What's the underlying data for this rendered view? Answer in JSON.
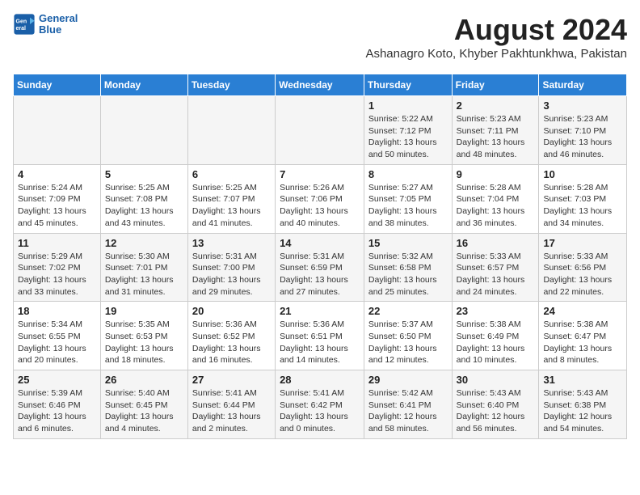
{
  "header": {
    "logo_line1": "General",
    "logo_line2": "Blue",
    "month_title": "August 2024",
    "subtitle": "Ashanagro Koto, Khyber Pakhtunkhwa, Pakistan"
  },
  "weekdays": [
    "Sunday",
    "Monday",
    "Tuesday",
    "Wednesday",
    "Thursday",
    "Friday",
    "Saturday"
  ],
  "weeks": [
    [
      {
        "day": "",
        "info": ""
      },
      {
        "day": "",
        "info": ""
      },
      {
        "day": "",
        "info": ""
      },
      {
        "day": "",
        "info": ""
      },
      {
        "day": "1",
        "info": "Sunrise: 5:22 AM\nSunset: 7:12 PM\nDaylight: 13 hours\nand 50 minutes."
      },
      {
        "day": "2",
        "info": "Sunrise: 5:23 AM\nSunset: 7:11 PM\nDaylight: 13 hours\nand 48 minutes."
      },
      {
        "day": "3",
        "info": "Sunrise: 5:23 AM\nSunset: 7:10 PM\nDaylight: 13 hours\nand 46 minutes."
      }
    ],
    [
      {
        "day": "4",
        "info": "Sunrise: 5:24 AM\nSunset: 7:09 PM\nDaylight: 13 hours\nand 45 minutes."
      },
      {
        "day": "5",
        "info": "Sunrise: 5:25 AM\nSunset: 7:08 PM\nDaylight: 13 hours\nand 43 minutes."
      },
      {
        "day": "6",
        "info": "Sunrise: 5:25 AM\nSunset: 7:07 PM\nDaylight: 13 hours\nand 41 minutes."
      },
      {
        "day": "7",
        "info": "Sunrise: 5:26 AM\nSunset: 7:06 PM\nDaylight: 13 hours\nand 40 minutes."
      },
      {
        "day": "8",
        "info": "Sunrise: 5:27 AM\nSunset: 7:05 PM\nDaylight: 13 hours\nand 38 minutes."
      },
      {
        "day": "9",
        "info": "Sunrise: 5:28 AM\nSunset: 7:04 PM\nDaylight: 13 hours\nand 36 minutes."
      },
      {
        "day": "10",
        "info": "Sunrise: 5:28 AM\nSunset: 7:03 PM\nDaylight: 13 hours\nand 34 minutes."
      }
    ],
    [
      {
        "day": "11",
        "info": "Sunrise: 5:29 AM\nSunset: 7:02 PM\nDaylight: 13 hours\nand 33 minutes."
      },
      {
        "day": "12",
        "info": "Sunrise: 5:30 AM\nSunset: 7:01 PM\nDaylight: 13 hours\nand 31 minutes."
      },
      {
        "day": "13",
        "info": "Sunrise: 5:31 AM\nSunset: 7:00 PM\nDaylight: 13 hours\nand 29 minutes."
      },
      {
        "day": "14",
        "info": "Sunrise: 5:31 AM\nSunset: 6:59 PM\nDaylight: 13 hours\nand 27 minutes."
      },
      {
        "day": "15",
        "info": "Sunrise: 5:32 AM\nSunset: 6:58 PM\nDaylight: 13 hours\nand 25 minutes."
      },
      {
        "day": "16",
        "info": "Sunrise: 5:33 AM\nSunset: 6:57 PM\nDaylight: 13 hours\nand 24 minutes."
      },
      {
        "day": "17",
        "info": "Sunrise: 5:33 AM\nSunset: 6:56 PM\nDaylight: 13 hours\nand 22 minutes."
      }
    ],
    [
      {
        "day": "18",
        "info": "Sunrise: 5:34 AM\nSunset: 6:55 PM\nDaylight: 13 hours\nand 20 minutes."
      },
      {
        "day": "19",
        "info": "Sunrise: 5:35 AM\nSunset: 6:53 PM\nDaylight: 13 hours\nand 18 minutes."
      },
      {
        "day": "20",
        "info": "Sunrise: 5:36 AM\nSunset: 6:52 PM\nDaylight: 13 hours\nand 16 minutes."
      },
      {
        "day": "21",
        "info": "Sunrise: 5:36 AM\nSunset: 6:51 PM\nDaylight: 13 hours\nand 14 minutes."
      },
      {
        "day": "22",
        "info": "Sunrise: 5:37 AM\nSunset: 6:50 PM\nDaylight: 13 hours\nand 12 minutes."
      },
      {
        "day": "23",
        "info": "Sunrise: 5:38 AM\nSunset: 6:49 PM\nDaylight: 13 hours\nand 10 minutes."
      },
      {
        "day": "24",
        "info": "Sunrise: 5:38 AM\nSunset: 6:47 PM\nDaylight: 13 hours\nand 8 minutes."
      }
    ],
    [
      {
        "day": "25",
        "info": "Sunrise: 5:39 AM\nSunset: 6:46 PM\nDaylight: 13 hours\nand 6 minutes."
      },
      {
        "day": "26",
        "info": "Sunrise: 5:40 AM\nSunset: 6:45 PM\nDaylight: 13 hours\nand 4 minutes."
      },
      {
        "day": "27",
        "info": "Sunrise: 5:41 AM\nSunset: 6:44 PM\nDaylight: 13 hours\nand 2 minutes."
      },
      {
        "day": "28",
        "info": "Sunrise: 5:41 AM\nSunset: 6:42 PM\nDaylight: 13 hours\nand 0 minutes."
      },
      {
        "day": "29",
        "info": "Sunrise: 5:42 AM\nSunset: 6:41 PM\nDaylight: 12 hours\nand 58 minutes."
      },
      {
        "day": "30",
        "info": "Sunrise: 5:43 AM\nSunset: 6:40 PM\nDaylight: 12 hours\nand 56 minutes."
      },
      {
        "day": "31",
        "info": "Sunrise: 5:43 AM\nSunset: 6:38 PM\nDaylight: 12 hours\nand 54 minutes."
      }
    ]
  ]
}
